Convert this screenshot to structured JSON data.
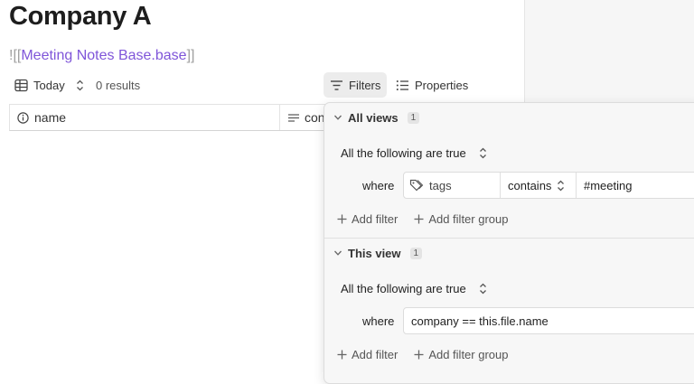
{
  "page": {
    "title": "Company A",
    "embed": {
      "open": "![[",
      "link": "Meeting Notes Base.base",
      "close": "]]"
    }
  },
  "toolbar": {
    "view_name": "Today",
    "results": "0 results",
    "filters_label": "Filters",
    "properties_label": "Properties"
  },
  "table": {
    "columns": [
      {
        "label": "name"
      },
      {
        "label": "con"
      }
    ]
  },
  "filters_popover": {
    "all_views": {
      "title": "All views",
      "count": "1",
      "mode": "All the following are true",
      "where": "where",
      "condition": {
        "property": "tags",
        "operator": "contains",
        "value": "#meeting"
      },
      "add_filter": "Add filter",
      "add_group": "Add filter group"
    },
    "this_view": {
      "title": "This view",
      "count": "1",
      "mode": "All the following are true",
      "where": "where",
      "condition": {
        "formula": "company == this.file.name"
      },
      "add_filter": "Add filter",
      "add_group": "Add filter group"
    }
  },
  "colors": {
    "link": "#7f55d9",
    "panel_bg": "#f7f7f7",
    "active_button_bg": "#ececec"
  }
}
